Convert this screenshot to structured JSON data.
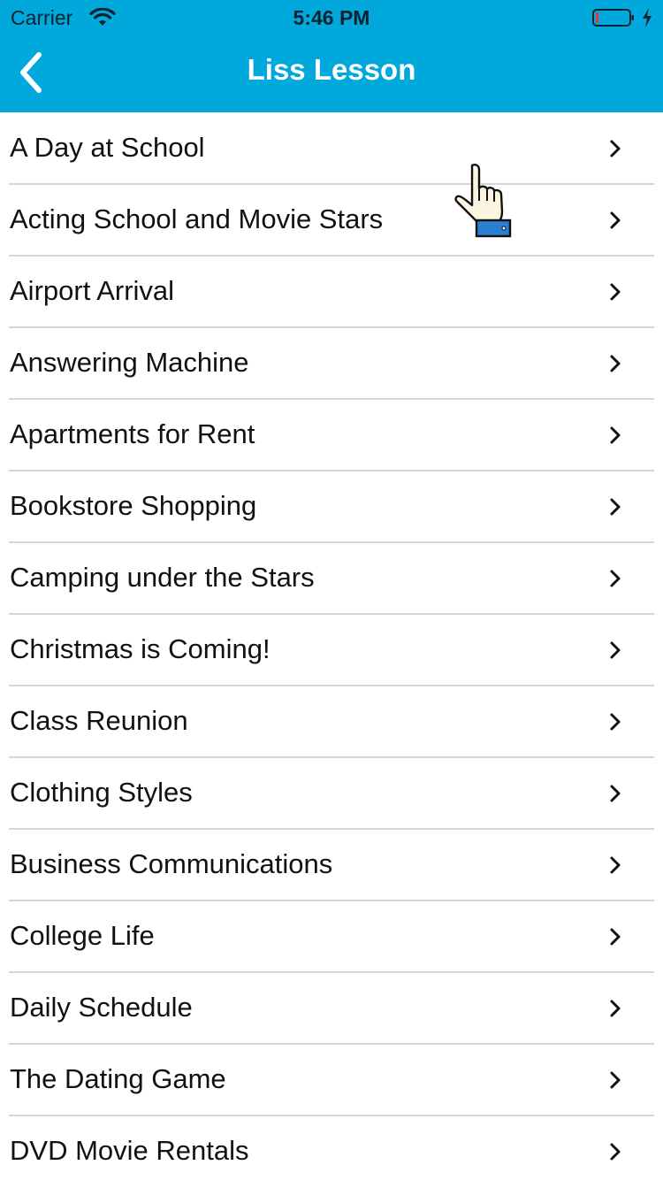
{
  "status_bar": {
    "carrier": "Carrier",
    "time": "5:46 PM",
    "icons": [
      "wifi-icon",
      "battery-icon",
      "charging-bolt-icon"
    ]
  },
  "nav": {
    "title": "Liss Lesson",
    "back_icon": "chevron-left-icon"
  },
  "lessons": [
    {
      "label": "A Day at School"
    },
    {
      "label": "Acting School and Movie Stars"
    },
    {
      "label": "Airport Arrival"
    },
    {
      "label": "Answering Machine"
    },
    {
      "label": "Apartments for Rent"
    },
    {
      "label": "Bookstore Shopping"
    },
    {
      "label": "Camping under the Stars"
    },
    {
      "label": "Christmas is Coming!"
    },
    {
      "label": "Class Reunion"
    },
    {
      "label": "Clothing Styles"
    },
    {
      "label": "Business Communications"
    },
    {
      "label": "College Life"
    },
    {
      "label": "Daily Schedule"
    },
    {
      "label": "The Dating Game"
    },
    {
      "label": "DVD Movie Rentals"
    }
  ],
  "colors": {
    "nav_background": "#00a8dc",
    "text": "#111111",
    "separator": "#d6d6d6"
  }
}
